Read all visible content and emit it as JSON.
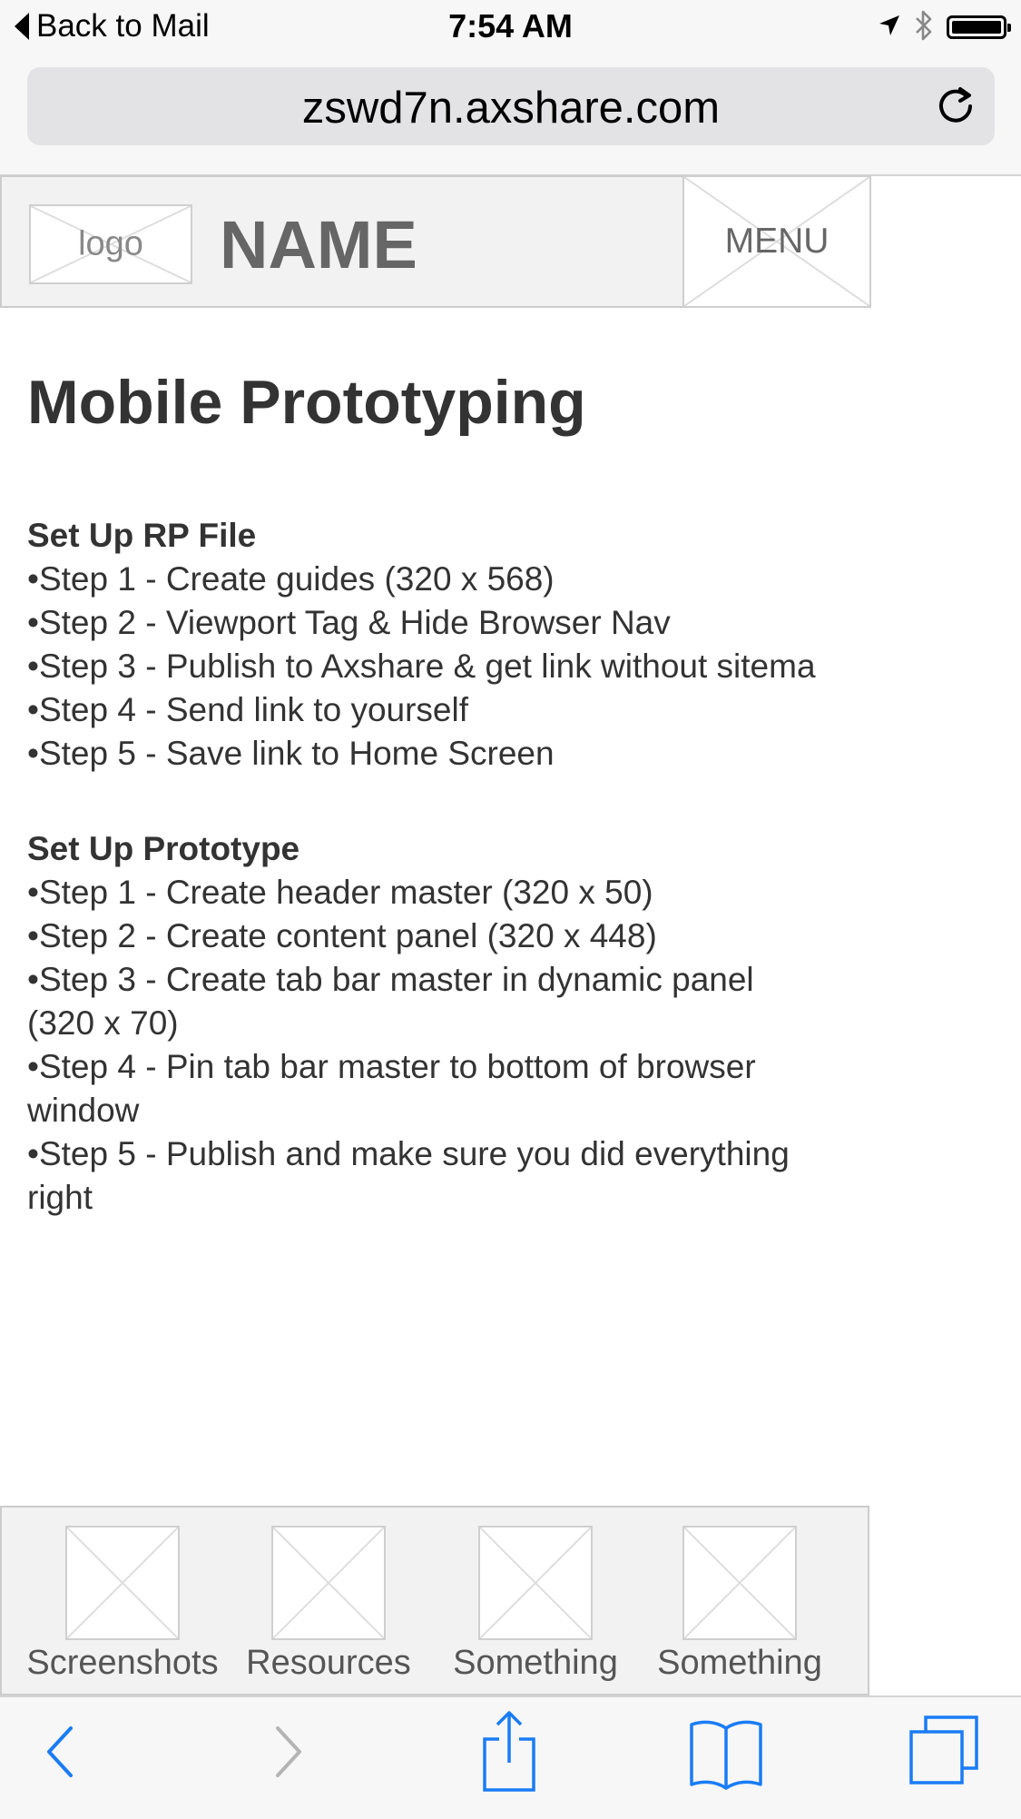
{
  "status_bar": {
    "back_label": "Back to Mail",
    "time": "7:54 AM",
    "icons": [
      "location-arrow-icon",
      "bluetooth-icon",
      "battery-icon"
    ]
  },
  "browser": {
    "url": "zswd7n.axshare.com",
    "toolbar_icons": [
      "back-arrow-icon",
      "forward-arrow-icon",
      "share-icon",
      "bookmarks-icon",
      "tabs-icon"
    ]
  },
  "header": {
    "logo_label": "logo",
    "name": "NAME",
    "menu_label": "MENU"
  },
  "main": {
    "title": "Mobile Prototyping",
    "sections": [
      {
        "heading": "Set Up RP File",
        "steps": [
          "Step 1 - Create guides (320 x 568)",
          "Step 2 - Viewport Tag & Hide Browser Nav",
          "Step 3 - Publish to Axshare & get link without sitema",
          "Step 4 - Send link to yourself",
          "Step 5 - Save link to Home Screen"
        ]
      },
      {
        "heading": "Set Up Prototype",
        "steps": [
          "Step 1 - Create header master (320 x 50)",
          "Step 2 - Create content panel (320 x 448)",
          "Step 3 - Create tab bar master in dynamic panel (320 x 70)",
          "Step 4 - Pin tab bar master to bottom of browser window",
          "Step 5 - Publish and make sure you did everything right"
        ]
      }
    ]
  },
  "tab_bar": {
    "tabs": [
      {
        "label": "Screenshots"
      },
      {
        "label": "Resources"
      },
      {
        "label": "Something"
      },
      {
        "label": "Something"
      }
    ]
  },
  "colors": {
    "ios_blue": "#1a7cf5",
    "placeholder_border": "#cfcfcf",
    "panel_bg": "#f2f2f2"
  }
}
